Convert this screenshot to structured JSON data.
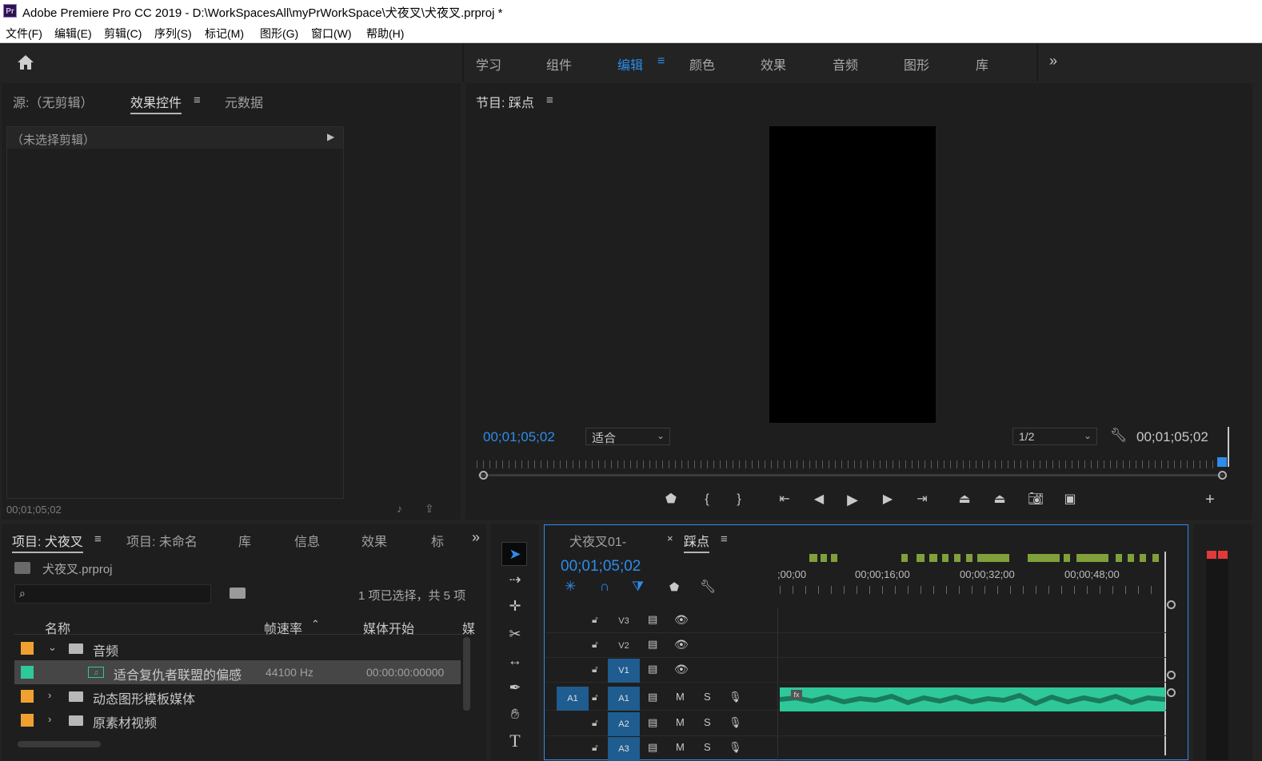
{
  "titlebar": {
    "logo": "Pr",
    "title": "Adobe Premiere Pro CC 2019 - D:\\WorkSpacesAll\\myPrWorkSpace\\犬夜叉\\犬夜叉.prproj *"
  },
  "menubar": {
    "items": [
      "文件(F)",
      "编辑(E)",
      "剪辑(C)",
      "序列(S)",
      "标记(M)",
      "图形(G)",
      "窗口(W)",
      "帮助(H)"
    ]
  },
  "workspaces": {
    "tabs": [
      "学习",
      "组件",
      "编辑",
      "颜色",
      "效果",
      "音频",
      "图形",
      "库"
    ],
    "active": "编辑",
    "menu_icon": "≡",
    "more_icon": "»"
  },
  "source_panel": {
    "tabs": [
      "源:（无剪辑）",
      "效果控件",
      "元数据"
    ],
    "active_tab": "效果控件",
    "no_clip": "（未选择剪辑）",
    "timecode": "00;01;05;02"
  },
  "program_monitor": {
    "title": "节目: 踩点",
    "timecode_left": "00;01;05;02",
    "fit": "适合",
    "resolution": "1/2",
    "timecode_right": "00;01;05;02"
  },
  "project_panel": {
    "tabs": [
      "项目: 犬夜叉",
      "项目: 未命名",
      "库",
      "信息",
      "效果",
      "标"
    ],
    "active_tab": "项目: 犬夜叉",
    "project_file": "犬夜叉.prproj",
    "search_placeholder": "",
    "selection_status": "1 项已选择，共 5 项",
    "columns": [
      "名称",
      "帧速率",
      "媒体开始",
      "媒"
    ],
    "rows": [
      {
        "color": "#f0a030",
        "expander": "⌄",
        "type": "folder",
        "name": "音频",
        "rate": "",
        "start": ""
      },
      {
        "color": "#2fc89a",
        "expander": "",
        "type": "audio",
        "name": "适合复仇者联盟的偏感",
        "rate": "44100 Hz",
        "start": "00:00:00:00000"
      },
      {
        "color": "#f0a030",
        "expander": "›",
        "type": "folder",
        "name": "动态图形模板媒体",
        "rate": "",
        "start": ""
      },
      {
        "color": "#f0a030",
        "expander": "›",
        "type": "folder",
        "name": "原素材视频",
        "rate": "",
        "start": ""
      }
    ]
  },
  "timeline": {
    "tabs": [
      "犬夜叉01-",
      "踩点"
    ],
    "active_tab": "踩点",
    "close_icon": "×",
    "timecode": "00;01;05;02",
    "ruler_labels": [
      ";00;00",
      "00;00;16;00",
      "00;00;32;00",
      "00;00;48;00"
    ],
    "tracks": [
      {
        "name": "V3",
        "target": false,
        "kind": "video"
      },
      {
        "name": "V2",
        "target": false,
        "kind": "video"
      },
      {
        "name": "V1",
        "target": true,
        "kind": "video"
      },
      {
        "name": "A1",
        "target": true,
        "kind": "audio",
        "source": "A1"
      },
      {
        "name": "A2",
        "target": true,
        "kind": "audio"
      },
      {
        "name": "A3",
        "target": true,
        "kind": "audio"
      }
    ],
    "mute_label": "M",
    "solo_label": "S",
    "clip_fx": "fx"
  },
  "colors": {
    "accent": "#2d8ceb",
    "audio_clip": "#2fc89a",
    "label_orange": "#f0a030",
    "marker_green": "#7fa03a"
  }
}
